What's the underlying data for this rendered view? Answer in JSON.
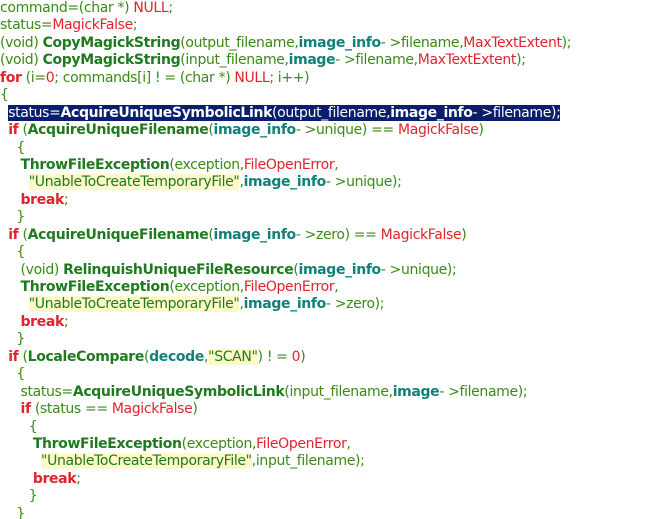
{
  "editor": {
    "lines": [
      {
        "indent": "",
        "tokens": [
          [
            "plain",
            "command=(char *) "
          ],
          [
            "red",
            "NULL"
          ],
          [
            "plain",
            ";"
          ]
        ]
      },
      {
        "indent": "",
        "tokens": [
          [
            "plain",
            "status="
          ],
          [
            "red",
            "MagickFalse"
          ],
          [
            "plain",
            ";"
          ]
        ]
      },
      {
        "indent": "",
        "tokens": [
          [
            "plain",
            "(void) "
          ],
          [
            "fn",
            "CopyMagickString"
          ],
          [
            "plain",
            "(output_filename,"
          ],
          [
            "var",
            "image_info"
          ],
          [
            "plain",
            "- >filename,"
          ],
          [
            "red",
            "MaxTextExtent"
          ],
          [
            "plain",
            ");"
          ]
        ]
      },
      {
        "indent": "",
        "tokens": [
          [
            "plain",
            "(void) "
          ],
          [
            "fn",
            "CopyMagickString"
          ],
          [
            "plain",
            "(input_filename,"
          ],
          [
            "var",
            "image"
          ],
          [
            "plain",
            "- >filename,"
          ],
          [
            "red",
            "MaxTextExtent"
          ],
          [
            "plain",
            ");"
          ]
        ]
      },
      {
        "indent": "",
        "tokens": [
          [
            "kw",
            "for"
          ],
          [
            "plain",
            " (i="
          ],
          [
            "num",
            "0"
          ],
          [
            "plain",
            "; commands[i] ! = (char *) "
          ],
          [
            "red",
            "NULL"
          ],
          [
            "plain",
            "; i++)"
          ]
        ]
      },
      {
        "indent": "",
        "tokens": [
          [
            "plain",
            "{"
          ]
        ]
      },
      {
        "indent": "  ",
        "selected": true,
        "tokens": [
          [
            "plain",
            "status="
          ],
          [
            "fn",
            "AcquireUniqueSymbolicLink"
          ],
          [
            "plain",
            "(output_filename,"
          ],
          [
            "var",
            "image_info"
          ],
          [
            "plain",
            "- >filename);"
          ]
        ]
      },
      {
        "indent": "  ",
        "tokens": [
          [
            "kw",
            "if"
          ],
          [
            "plain",
            " ("
          ],
          [
            "fn",
            "AcquireUniqueFilename"
          ],
          [
            "plain",
            "("
          ],
          [
            "var",
            "image_info"
          ],
          [
            "plain",
            "- >unique) == "
          ],
          [
            "red",
            "MagickFalse"
          ],
          [
            "plain",
            ")"
          ]
        ]
      },
      {
        "indent": "    ",
        "tokens": [
          [
            "plain",
            "{"
          ]
        ]
      },
      {
        "indent": "     ",
        "tokens": [
          [
            "fn",
            "ThrowFileException"
          ],
          [
            "plain",
            "(exception,"
          ],
          [
            "red",
            "FileOpenError"
          ],
          [
            "plain",
            ","
          ]
        ]
      },
      {
        "indent": "       ",
        "tokens": [
          [
            "str",
            "\"UnableToCreateTemporaryFile\""
          ],
          [
            "plain",
            ","
          ],
          [
            "var",
            "image_info"
          ],
          [
            "plain",
            "- >unique);"
          ]
        ]
      },
      {
        "indent": "     ",
        "tokens": [
          [
            "kw",
            "break"
          ],
          [
            "plain",
            ";"
          ]
        ]
      },
      {
        "indent": "    ",
        "tokens": [
          [
            "plain",
            "}"
          ]
        ]
      },
      {
        "indent": "  ",
        "tokens": [
          [
            "kw",
            "if"
          ],
          [
            "plain",
            " ("
          ],
          [
            "fn",
            "AcquireUniqueFilename"
          ],
          [
            "plain",
            "("
          ],
          [
            "var",
            "image_info"
          ],
          [
            "plain",
            "- >zero) == "
          ],
          [
            "red",
            "MagickFalse"
          ],
          [
            "plain",
            ")"
          ]
        ]
      },
      {
        "indent": "    ",
        "tokens": [
          [
            "plain",
            "{"
          ]
        ]
      },
      {
        "indent": "     ",
        "tokens": [
          [
            "plain",
            "(void) "
          ],
          [
            "fn",
            "RelinquishUniqueFileResource"
          ],
          [
            "plain",
            "("
          ],
          [
            "var",
            "image_info"
          ],
          [
            "plain",
            "- >unique);"
          ]
        ]
      },
      {
        "indent": "     ",
        "tokens": [
          [
            "fn",
            "ThrowFileException"
          ],
          [
            "plain",
            "(exception,"
          ],
          [
            "red",
            "FileOpenError"
          ],
          [
            "plain",
            ","
          ]
        ]
      },
      {
        "indent": "       ",
        "tokens": [
          [
            "str",
            "\"UnableToCreateTemporaryFile\""
          ],
          [
            "plain",
            ","
          ],
          [
            "var",
            "image_info"
          ],
          [
            "plain",
            "- >zero);"
          ]
        ]
      },
      {
        "indent": "     ",
        "tokens": [
          [
            "kw",
            "break"
          ],
          [
            "plain",
            ";"
          ]
        ]
      },
      {
        "indent": "    ",
        "tokens": [
          [
            "plain",
            "}"
          ]
        ]
      },
      {
        "indent": "  ",
        "tokens": [
          [
            "kw",
            "if"
          ],
          [
            "plain",
            " ("
          ],
          [
            "fn",
            "LocaleCompare"
          ],
          [
            "plain",
            "("
          ],
          [
            "var",
            "decode"
          ],
          [
            "plain",
            ","
          ],
          [
            "str",
            "\"SCAN\""
          ],
          [
            "plain",
            ") ! = "
          ],
          [
            "num",
            "0"
          ],
          [
            "plain",
            ")"
          ]
        ]
      },
      {
        "indent": "    ",
        "tokens": [
          [
            "plain",
            "{"
          ]
        ]
      },
      {
        "indent": "     ",
        "tokens": [
          [
            "plain",
            "status="
          ],
          [
            "fn",
            "AcquireUniqueSymbolicLink"
          ],
          [
            "plain",
            "(input_filename,"
          ],
          [
            "var",
            "image"
          ],
          [
            "plain",
            "- >filename);"
          ]
        ]
      },
      {
        "indent": "     ",
        "tokens": [
          [
            "kw",
            "if"
          ],
          [
            "plain",
            " (status == "
          ],
          [
            "red",
            "MagickFalse"
          ],
          [
            "plain",
            ")"
          ]
        ]
      },
      {
        "indent": "       ",
        "tokens": [
          [
            "plain",
            "{"
          ]
        ]
      },
      {
        "indent": "        ",
        "tokens": [
          [
            "fn",
            "ThrowFileException"
          ],
          [
            "plain",
            "(exception,"
          ],
          [
            "red",
            "FileOpenError"
          ],
          [
            "plain",
            ","
          ]
        ]
      },
      {
        "indent": "          ",
        "tokens": [
          [
            "str",
            "\"UnableToCreateTemporaryFile\""
          ],
          [
            "plain",
            ",input_filename);"
          ]
        ]
      },
      {
        "indent": "        ",
        "tokens": [
          [
            "kw",
            "break"
          ],
          [
            "plain",
            ";"
          ]
        ]
      },
      {
        "indent": "       ",
        "tokens": [
          [
            "plain",
            "}"
          ]
        ]
      },
      {
        "indent": "    ",
        "tokens": [
          [
            "plain",
            "}"
          ]
        ]
      }
    ]
  }
}
